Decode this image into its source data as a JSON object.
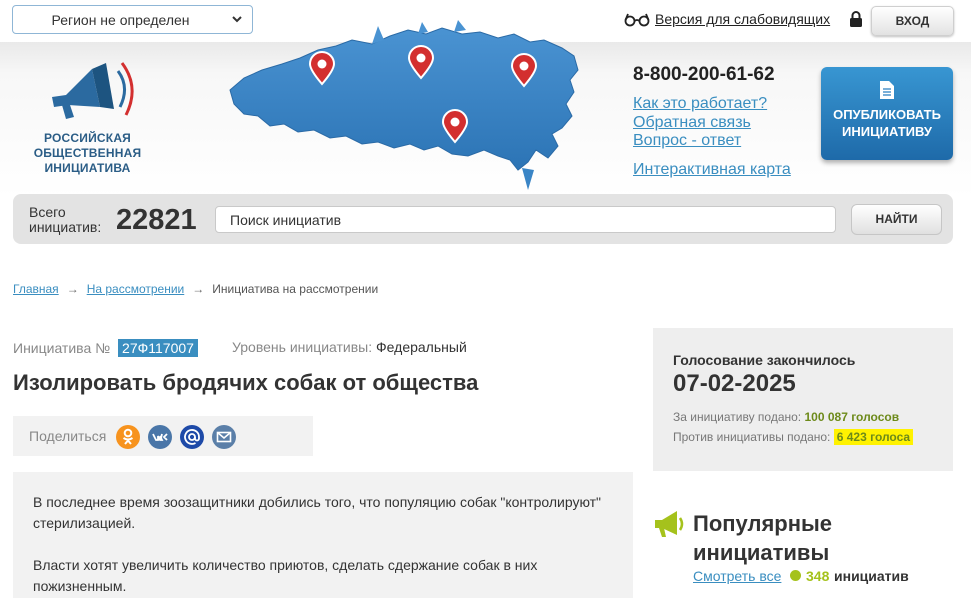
{
  "topbar": {
    "region_select": "Регион не определен",
    "vision_link": "Версия для слабовидящих",
    "login_button": "ВХОД"
  },
  "header": {
    "logo_text": "РОССИЙСКАЯ ОБЩЕСТВЕННАЯ ИНИЦИАТИВА",
    "phone": "8-800-200-61-62",
    "links": [
      "Как это работает?",
      "Обратная связь",
      "Вопрос - ответ",
      "Интерактивная карта"
    ],
    "publish_button": "ОПУБЛИКОВАТЬ ИНИЦИАТИВУ"
  },
  "search": {
    "total_label_line1": "Всего",
    "total_label_line2": "инициатив:",
    "total_count": "22821",
    "placeholder": "Поиск инициатив",
    "button": "НАЙТИ"
  },
  "breadcrumb": {
    "home": "Главная",
    "section": "На рассмотрении",
    "current": "Инициатива на рассмотрении"
  },
  "initiative": {
    "number_label": "Инициатива №",
    "number": "27Ф117007",
    "level_label": "Уровень инициативы:",
    "level_value": "Федеральный",
    "title": "Изолировать бродячих собак от общества",
    "share_label": "Поделиться",
    "paragraphs": [
      "В последнее время зоозащитники добились того, что популяцию собак \"контролируют\" стерилизацией.",
      "Власти хотят увеличить количество приютов, сделать сдержание собак в них пожизненным."
    ]
  },
  "vote": {
    "status": "Голосование закончилось",
    "date": "07-02-2025",
    "for_label": "За инициативу подано:",
    "for_value": "100 087 голосов",
    "against_label": "Против инициативы подано:",
    "against_value": "6 423 голоса"
  },
  "popular": {
    "title_line1": "Популярные",
    "title_line2": "инициативы",
    "link": "Смотреть все",
    "count": "348",
    "count_label": "инициатив"
  },
  "colors": {
    "accent_blue": "#3a8ec0",
    "button_blue": "#2a7fc0",
    "green": "#a5c21c",
    "highlight": "#fff200"
  }
}
